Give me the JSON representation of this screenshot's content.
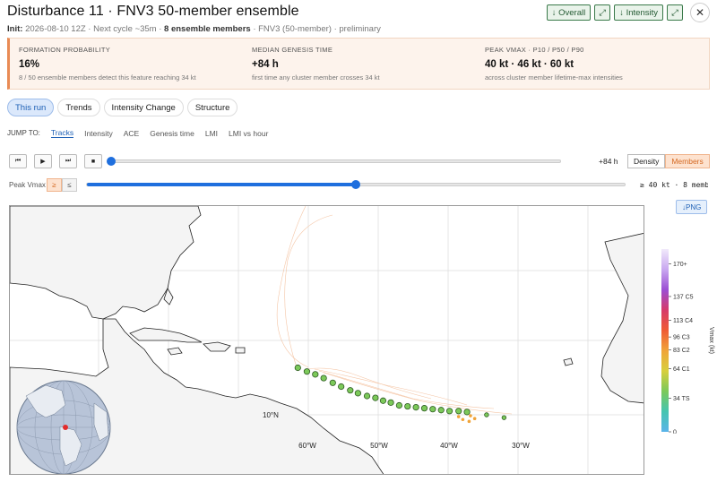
{
  "header": {
    "title": "Disturbance 11 · FNV3 50-member ensemble",
    "init_label": "Init:",
    "init_value": "2026-08-10 12Z · Next cycle ~35m ·",
    "members_bold": "8 ensemble members",
    "tail": "· FNV3 (50-member) · preliminary"
  },
  "actions": {
    "overall": "↓ Overall",
    "expand1": "⤢",
    "intensity": "↓ Intensity",
    "expand2": "⤢",
    "close": "✕"
  },
  "summary": [
    {
      "label": "FORMATION PROBABILITY",
      "value": "16%",
      "sub": "8 / 50 ensemble members detect this feature reaching 34 kt"
    },
    {
      "label": "MEDIAN GENESIS TIME",
      "value": "+84 h",
      "sub": "first time any cluster member crosses 34 kt"
    },
    {
      "label": "PEAK VMAX · P10 / P50 / P90",
      "value": "40 kt · 46 kt · 60 kt",
      "sub": "across cluster member lifetime-max intensities"
    }
  ],
  "tabs": [
    "This run",
    "Trends",
    "Intensity Change",
    "Structure"
  ],
  "jump": {
    "label": "JUMP TO:",
    "links": [
      "Tracks",
      "Intensity",
      "ACE",
      "Genesis time",
      "LMI",
      "LMI vs hour"
    ]
  },
  "player": {
    "buttons": [
      "⏮",
      "▶",
      "⏭",
      "■"
    ],
    "progress": 0.0,
    "hour_label": "+84 h",
    "mode_density": "Density",
    "mode_members": "Members"
  },
  "vmax_filter": {
    "label": "Peak Vmax",
    "ge": "≥",
    "le": "≤",
    "threshold_fraction": 0.5,
    "readout": "≥ 40 kt · 8 memb"
  },
  "png_button": "↓PNG",
  "map": {
    "lon_labels": [
      "60°W",
      "50°W",
      "40°W",
      "30°W"
    ],
    "lat_label": "10°N",
    "points": [
      {
        "lon": -61.5,
        "lat": 15.0
      },
      {
        "lon": -60.2,
        "lat": 14.6
      },
      {
        "lon": -59.0,
        "lat": 14.3
      },
      {
        "lon": -57.8,
        "lat": 13.9
      },
      {
        "lon": -56.5,
        "lat": 13.4
      },
      {
        "lon": -55.3,
        "lat": 13.0
      },
      {
        "lon": -54.0,
        "lat": 12.6
      },
      {
        "lon": -52.9,
        "lat": 12.3
      },
      {
        "lon": -51.6,
        "lat": 12.0
      },
      {
        "lon": -50.4,
        "lat": 11.8
      },
      {
        "lon": -49.3,
        "lat": 11.5
      },
      {
        "lon": -48.2,
        "lat": 11.3
      },
      {
        "lon": -47.0,
        "lat": 11.0
      },
      {
        "lon": -45.8,
        "lat": 10.9
      },
      {
        "lon": -44.6,
        "lat": 10.8
      },
      {
        "lon": -43.4,
        "lat": 10.7
      },
      {
        "lon": -42.2,
        "lat": 10.6
      },
      {
        "lon": -41.0,
        "lat": 10.5
      },
      {
        "lon": -39.8,
        "lat": 10.4
      },
      {
        "lon": -38.5,
        "lat": 10.4
      },
      {
        "lon": -37.3,
        "lat": 10.3
      },
      {
        "lon": -34.5,
        "lat": 10.0
      },
      {
        "lon": -32.0,
        "lat": 9.7
      }
    ]
  },
  "colorbar": {
    "title": "Vmax (kt)",
    "ticks": [
      {
        "kt": 0,
        "label": "0"
      },
      {
        "kt": 34,
        "label": "34 TS"
      },
      {
        "kt": 64,
        "label": "64 C1"
      },
      {
        "kt": 83,
        "label": "83 C2"
      },
      {
        "kt": 96,
        "label": "96 C3"
      },
      {
        "kt": 113,
        "label": "113 C4"
      },
      {
        "kt": 137,
        "label": "137 C5"
      },
      {
        "kt": 170,
        "label": "170+"
      }
    ],
    "colors": [
      "#5ab4ea",
      "#45c5b0",
      "#7cc95a",
      "#d8cf3c",
      "#f0a43a",
      "#ef5b34",
      "#d63a6a",
      "#9b4fd4",
      "#c9a8f0",
      "#f1e9fb"
    ]
  }
}
